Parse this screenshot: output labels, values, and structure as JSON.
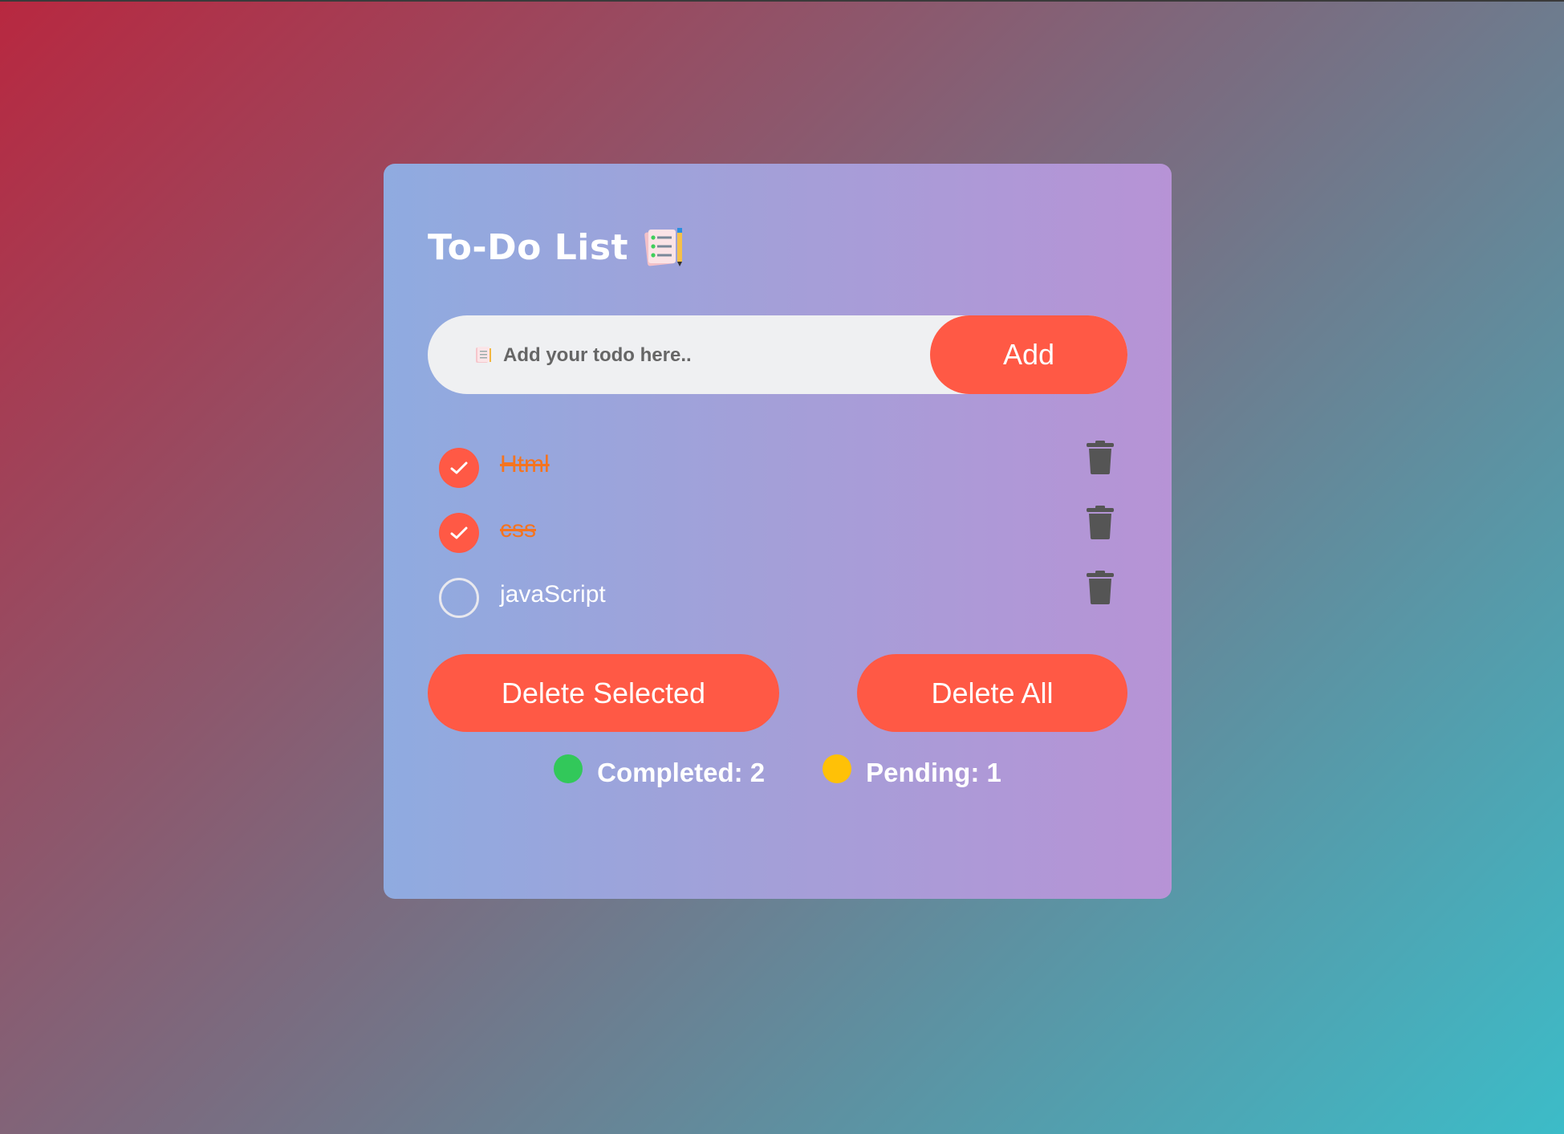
{
  "app": {
    "title": "To-Do List",
    "title_icon": "notepad-pencil-icon"
  },
  "input": {
    "placeholder": "Add your todo here..",
    "value": "",
    "icon": "memo-icon",
    "add_label": "Add"
  },
  "todos": [
    {
      "text": "Html",
      "completed": true
    },
    {
      "text": "css",
      "completed": true
    },
    {
      "text": "javaScript",
      "completed": false
    }
  ],
  "actions": {
    "delete_selected_label": "Delete Selected",
    "delete_all_label": "Delete All"
  },
  "stats": {
    "completed_label": "Completed: 2",
    "pending_label": "Pending: 1"
  },
  "colors": {
    "accent": "#ff5945",
    "completed_text": "#f5741f",
    "completed_dot": "#32c85a",
    "pending_dot": "#ffc107",
    "trash_icon": "#555555"
  }
}
